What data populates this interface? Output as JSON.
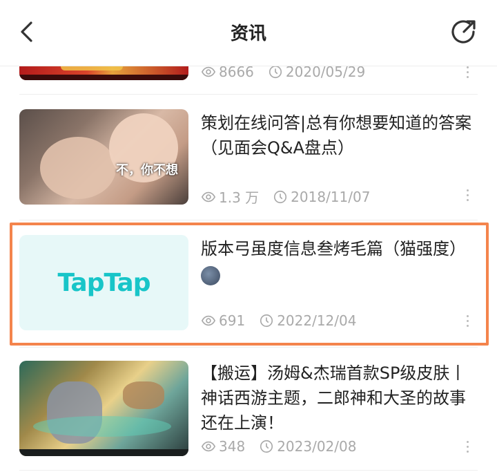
{
  "header": {
    "title": "资讯"
  },
  "items": [
    {
      "views": "8666",
      "date": "2020/05/29"
    },
    {
      "title_line1": "策划在线问答|总有你想要知道的答案",
      "title_line2": "（见面会Q&A盘点）",
      "thumb_caption": "不，你不想",
      "views": "1.3 万",
      "date": "2018/11/07"
    },
    {
      "title_line1": "版本弓虽度信息叁烤毛篇（猫强度）",
      "thumb_logo": "TapTap",
      "views": "691",
      "date": "2022/12/04"
    },
    {
      "title_line1": "【搬运】汤姆&杰瑞首款SP级皮肤丨",
      "title_line2": "神话西游主题，二郎神和大圣的故事",
      "title_line3": "还在上演！",
      "views": "348",
      "date": "2023/02/08"
    }
  ],
  "colors": {
    "highlight": "#f4844c",
    "taptap": "#18c5c8",
    "meta": "#a9a9a9"
  }
}
